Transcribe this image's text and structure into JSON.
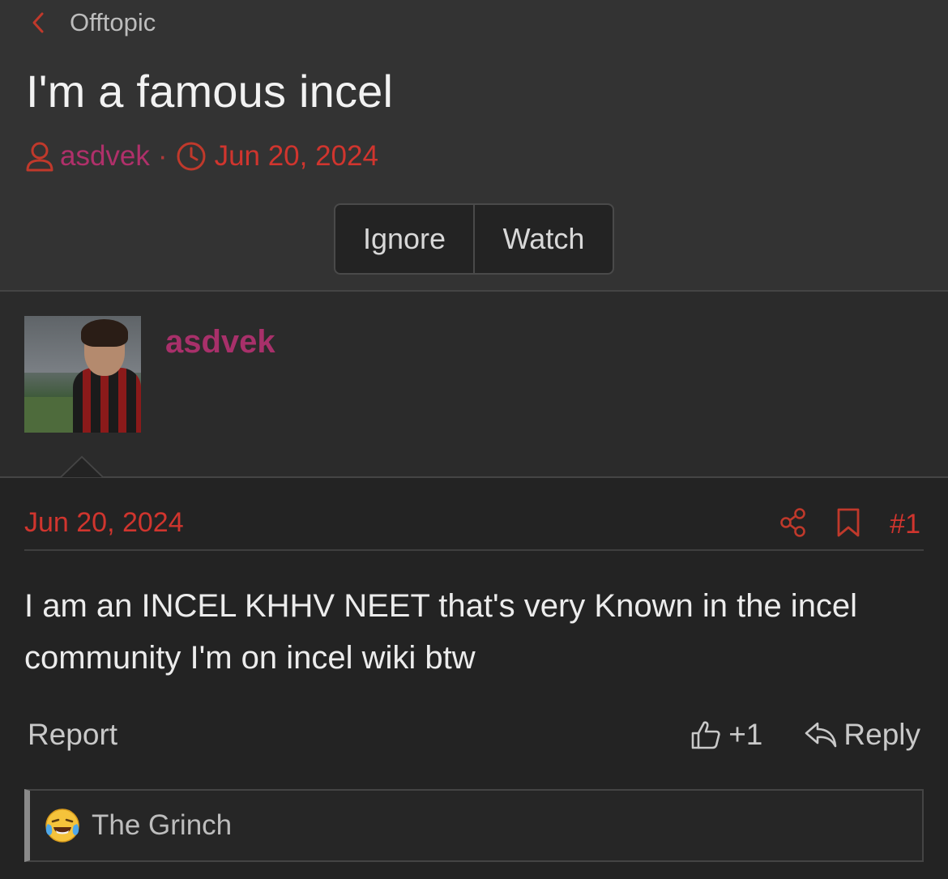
{
  "breadcrumb": {
    "label": "Offtopic"
  },
  "thread": {
    "title": "I'm a famous incel",
    "author": "asdvek",
    "separator": "·",
    "date": "Jun 20, 2024"
  },
  "thread_buttons": {
    "ignore": "Ignore",
    "watch": "Watch"
  },
  "post": {
    "author": "asdvek",
    "date": "Jun 20, 2024",
    "number": "#1",
    "body": "I am an INCEL KHHV NEET that's very Known in the incel community I'm on incel wiki btw",
    "report_label": "Report",
    "like_count": "+1",
    "reply_label": "Reply"
  },
  "reactions": {
    "reactor": "The Grinch"
  },
  "colors": {
    "accent_red": "#d0352e",
    "username": "#a8306a",
    "background": "#2e2e2e"
  },
  "icons": [
    "chevron-left-icon",
    "user-icon",
    "clock-icon",
    "share-icon",
    "bookmark-icon",
    "thumbs-up-icon",
    "reply-icon",
    "laughing-crying-emoji"
  ]
}
